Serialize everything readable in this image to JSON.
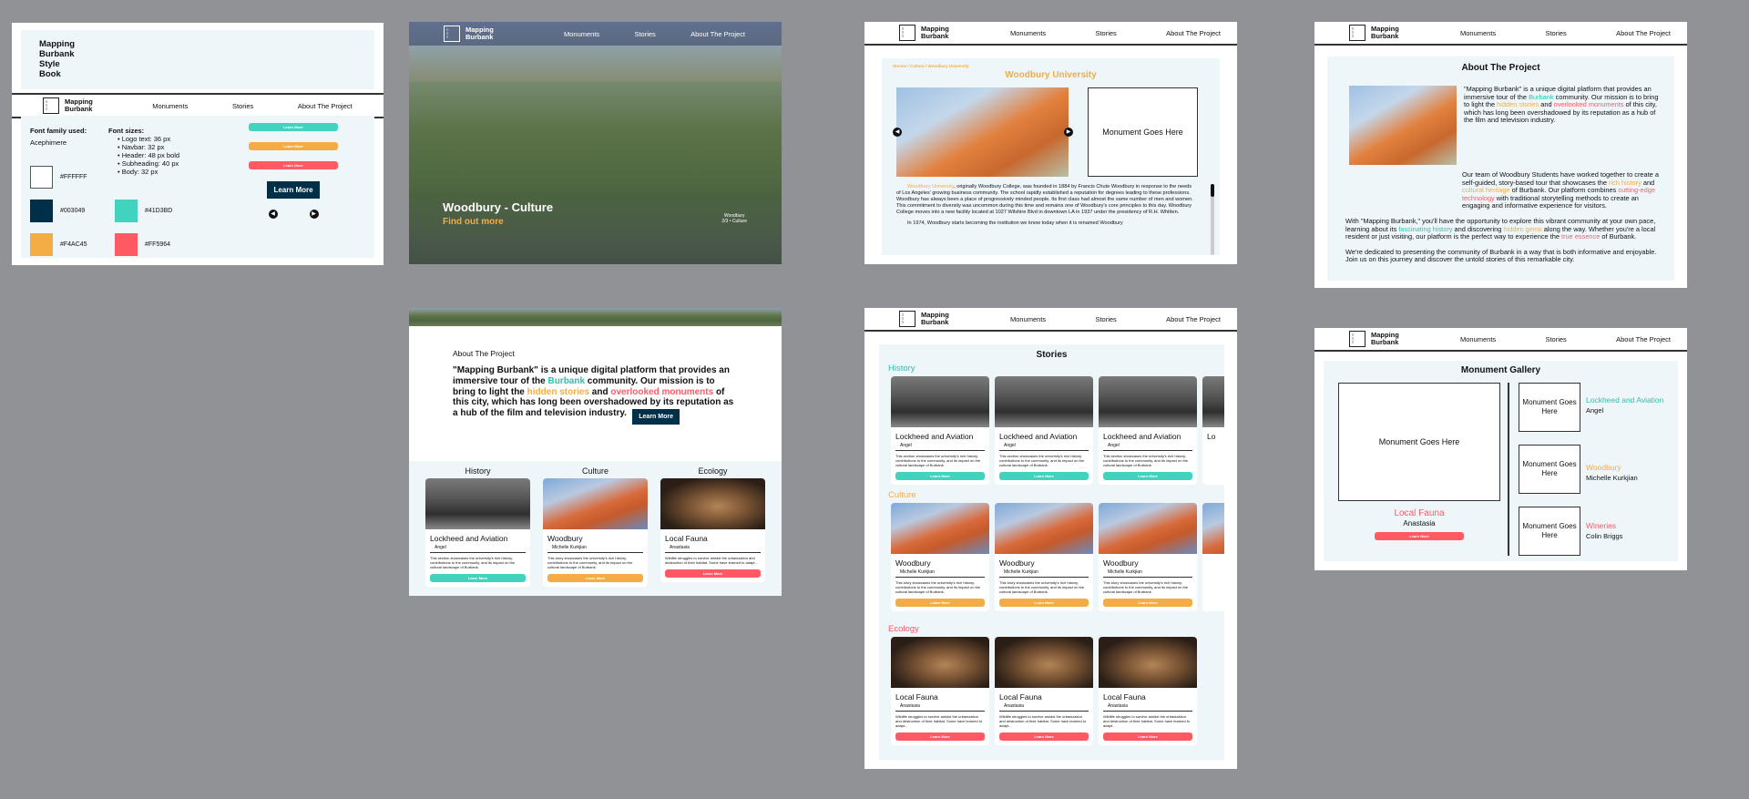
{
  "brand": {
    "line1": "Mapping",
    "line2": "Burbank"
  },
  "nav": {
    "monuments": "Monuments",
    "stories": "Stories",
    "about": "About The Project"
  },
  "styleguide": {
    "title_lines": [
      "Mapping",
      "Burbank",
      "Style",
      "Book"
    ],
    "font_family_label": "Font family used:",
    "font_family": "Acephimere",
    "font_sizes_label": "Font sizes:",
    "font_sizes": [
      "Logo text: 36 px",
      "Navbar: 32 px",
      "Header: 48 px bold",
      "Subheading: 40 px",
      "Body: 32 px"
    ],
    "colors": [
      {
        "hex": "#FFFFFF",
        "label": "#FFFFFF"
      },
      {
        "hex": "#41D3BD",
        "label": "#41D3BD"
      },
      {
        "hex": "#003049",
        "label": "#003049"
      },
      {
        "hex": "#FF5964",
        "label": "#FF5964"
      },
      {
        "hex": "#F4AC45",
        "label": "#F4AC45"
      }
    ],
    "pill_label": "Learn More",
    "button_label": "Learn More"
  },
  "hero": {
    "title": "Woodbury - Culture",
    "link": "Find out more",
    "caption_line1": "Woodbury",
    "caption_line2": "2/3 • Culture"
  },
  "article": {
    "breadcrumb": "Stories / Culture / Woodbury University",
    "title": "Woodbury University",
    "monument_placeholder": "Monument Goes Here",
    "body_highlight": "Woodbury University",
    "body": ", originally Woodbury College, was founded in 1884 by Francis Chute Woodbury in response to the needs of Los Angeles' growing business community. The school rapidly established a reputation for degrees leading to these professions. Woodbury has always been a place of progressively minded people. Its first class had almost the same number of men and women. This commitment to diversity was uncommon during this time and remains one of Woodbury's core principles to this day. Woodbury College moves into a new facility located at 1027 Wilshire Blvd in downtown LA in 1937 under the presidency of R.H. Whitten.",
    "body2": "In 1974, Woodbury starts becoming the institution we know today when it is renamed Woodbury"
  },
  "about": {
    "title": "About The Project",
    "p1a": "\"Mapping Burbank\" is a unique digital platform that provides an immersive tour of the ",
    "p1b": "Burbank",
    "p1c": " community. Our mission is to bring to light the ",
    "p1d": "hidden stories",
    "p1e": " and ",
    "p1f": "overlooked monuments",
    "p1g": " of this city, which has long been overshadowed by its reputation as a hub of the film and television industry.",
    "p2a": "Our team of Woodbury Students have worked together to create a self-guided, story-based tour that showcases the ",
    "p2b": "rich history",
    "p2c": " and ",
    "p2d": "cultural heritage",
    "p2e": " of Burbank. Our platform combines ",
    "p2f": "cutting-edge technology",
    "p2g": " with traditional storytelling methods to create an engaging and informative experience for visitors.",
    "p3a": "With \"Mapping Burbank,\" you'll have the opportunity to explore this vibrant community at your own pace, learning about its ",
    "p3b": "fascinating history",
    "p3c": " and discovering ",
    "p3d": "hidden gems",
    "p3e": " along the way. Whether you're a local resident or just visiting, our platform is the perfect way to experience the ",
    "p3f": "true essence",
    "p3g": " of Burbank.",
    "p4": "We're dedicated to presenting the community of Burbank in a way that is both informative and enjoyable. Join us on this journey and discover the untold stories of this remarkable city.",
    "button": "Learn More"
  },
  "categories": {
    "history": "History",
    "culture": "Culture",
    "ecology": "Ecology"
  },
  "cards": {
    "history": {
      "title": "Lockheed and Aviation",
      "author": "Angel",
      "desc": "This section showcases the university's rich history, contributions to the community, and its impact on the cultural landscape of Burbank."
    },
    "culture": {
      "title": "Woodbury",
      "author": "Michelle Kurkjian",
      "desc": "This story showcases the university's rich history, contributions to the community, and its impact on the cultural landscape of Burbank."
    },
    "ecology": {
      "title": "Local Fauna",
      "author": "Anastasia",
      "desc": "Wildlife struggles to survive amidst the urbanization and destruction of their habitat. Some have learned to adapt..."
    },
    "button": "Learn More"
  },
  "stories_page": {
    "title": "Stories",
    "partial": "Lo"
  },
  "gallery": {
    "title": "Monument Gallery",
    "placeholder": "Monument Goes Here",
    "main_title": "Local Fauna",
    "main_author": "Anastasia",
    "main_button": "Learn More",
    "items": [
      {
        "title": "Lockheed and Aviation",
        "author": "Angel"
      },
      {
        "title": "Woodbury",
        "author": "Michelle Kurkjian"
      },
      {
        "title": "Wineries",
        "author": "Colin Briggs"
      }
    ]
  }
}
